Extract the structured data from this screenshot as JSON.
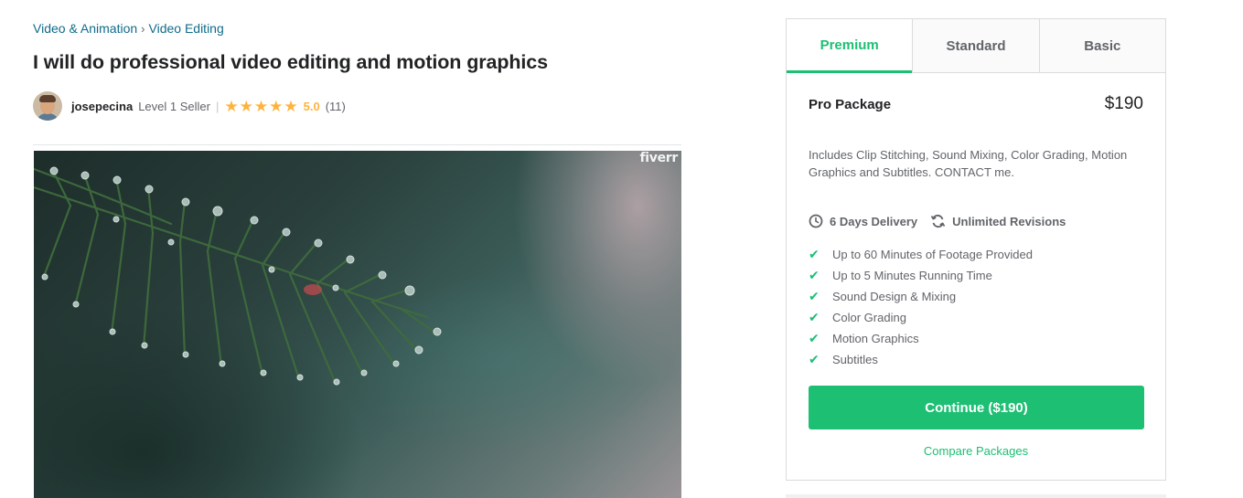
{
  "breadcrumb": {
    "category": "Video & Animation",
    "separator": "›",
    "subcategory": "Video Editing"
  },
  "gig": {
    "title": "I will do professional video editing and motion graphics"
  },
  "seller": {
    "name": "josepecina",
    "level": "Level 1 Seller",
    "separator": "|",
    "stars": 5,
    "rating": "5.0",
    "reviews": "(11)"
  },
  "hero": {
    "watermark": "fiverr"
  },
  "packages": {
    "tabs": [
      {
        "label": "Premium",
        "active": true
      },
      {
        "label": "Standard",
        "active": false
      },
      {
        "label": "Basic",
        "active": false
      }
    ],
    "name": "Pro Package",
    "price": "$190",
    "description": "Includes Clip Stitching, Sound Mixing, Color Grading, Motion Graphics and Subtitles. CONTACT me.",
    "delivery": "6 Days Delivery",
    "revisions": "Unlimited Revisions",
    "features": [
      "Up to 60 Minutes of Footage Provided",
      "Up to 5 Minutes Running Time",
      "Sound Design & Mixing",
      "Color Grading",
      "Motion Graphics",
      "Subtitles"
    ],
    "continue_label": "Continue ($190)",
    "compare_label": "Compare Packages"
  },
  "colors": {
    "brand_green": "#1dbf73",
    "star_yellow": "#ffb33e",
    "link_teal": "#0f6b8a"
  }
}
